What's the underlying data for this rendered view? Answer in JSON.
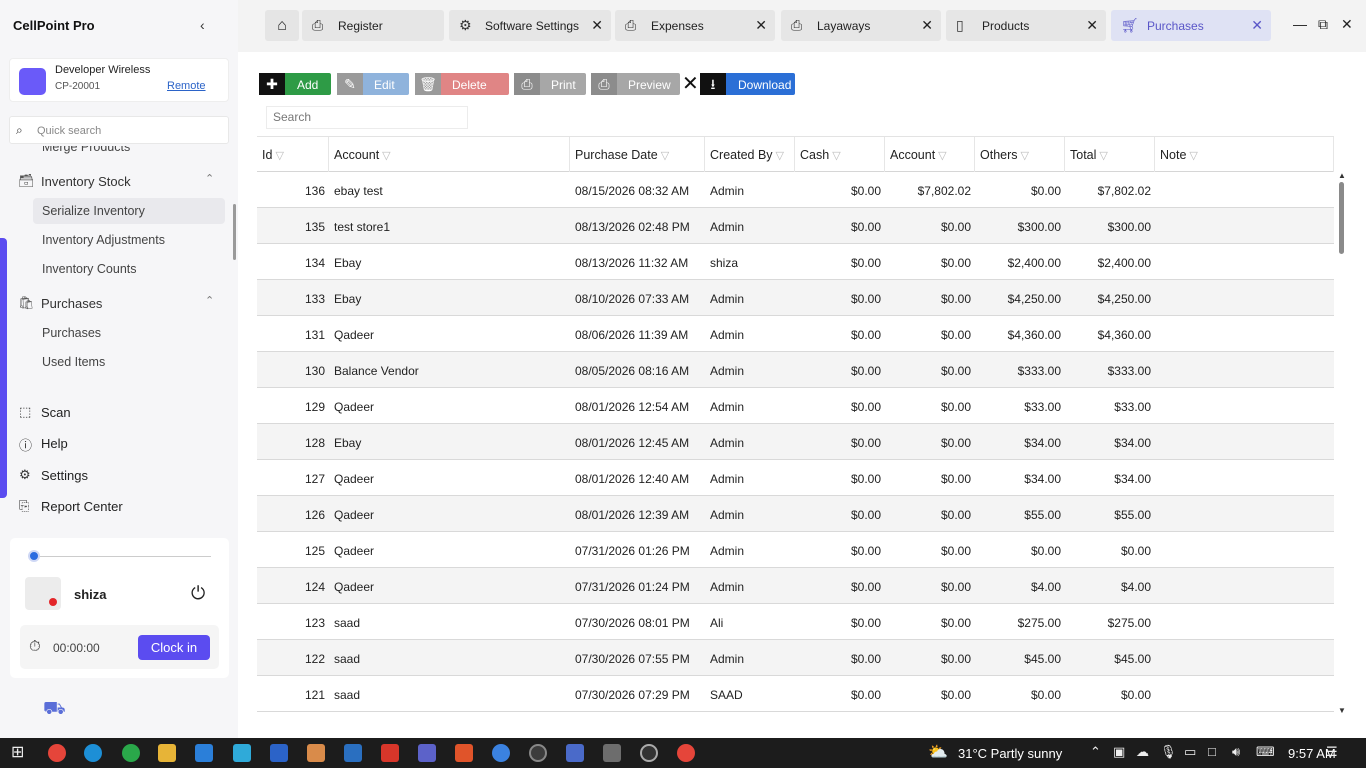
{
  "app": {
    "title": "CellPoint Pro"
  },
  "store": {
    "name": "Developer Wireless",
    "id": "CP-20001",
    "remote_label": "Remote"
  },
  "search": {
    "placeholder": "Quick search"
  },
  "sidebar": {
    "items": [
      {
        "label": "Merge Products"
      },
      {
        "label": "Inventory Stock",
        "icon": "box-icon"
      },
      {
        "label": "Serialize Inventory"
      },
      {
        "label": "Inventory Adjustments"
      },
      {
        "label": "Inventory Counts"
      },
      {
        "label": "Purchases",
        "icon": "bag-icon"
      },
      {
        "label": "Purchases"
      },
      {
        "label": "Used Items"
      }
    ],
    "bottom": [
      {
        "label": "Scan",
        "icon": "scan-icon"
      },
      {
        "label": "Help",
        "icon": "help-icon"
      },
      {
        "label": "Settings",
        "icon": "gear-icon"
      },
      {
        "label": "Report Center",
        "icon": "report-icon"
      }
    ]
  },
  "user": {
    "name": "shiza",
    "timer": "00:00:00",
    "clock_in_label": "Clock in"
  },
  "tabs": [
    {
      "label": "Register",
      "icon": "printer-icon"
    },
    {
      "label": "Software Settings",
      "icon": "settings-icon"
    },
    {
      "label": "Expenses",
      "icon": "printer-icon"
    },
    {
      "label": "Layaways",
      "icon": "printer-icon"
    },
    {
      "label": "Products",
      "icon": "phone-icon"
    },
    {
      "label": "Purchases",
      "icon": "basket-icon",
      "active": true
    }
  ],
  "toolbar": {
    "add": "Add",
    "edit": "Edit",
    "delete": "Delete",
    "print": "Print",
    "preview": "Preview",
    "download": "Download",
    "search_placeholder": "Search"
  },
  "table": {
    "columns": [
      "Id",
      "Account",
      "Purchase Date",
      "Created By",
      "Cash",
      "Account",
      "Others",
      "Total",
      "Note"
    ],
    "rows": [
      [
        "136",
        "ebay test",
        "08/15/2026 08:32 AM",
        "Admin",
        "$0.00",
        "$7,802.02",
        "$0.00",
        "$7,802.02",
        ""
      ],
      [
        "135",
        "test store1",
        "08/13/2026 02:48 PM",
        "Admin",
        "$0.00",
        "$0.00",
        "$300.00",
        "$300.00",
        ""
      ],
      [
        "134",
        "Ebay",
        "08/13/2026 11:32 AM",
        "shiza",
        "$0.00",
        "$0.00",
        "$2,400.00",
        "$2,400.00",
        ""
      ],
      [
        "133",
        "Ebay",
        "08/10/2026 07:33 AM",
        "Admin",
        "$0.00",
        "$0.00",
        "$4,250.00",
        "$4,250.00",
        ""
      ],
      [
        "131",
        "Qadeer",
        "08/06/2026 11:39 AM",
        "Admin",
        "$0.00",
        "$0.00",
        "$4,360.00",
        "$4,360.00",
        ""
      ],
      [
        "130",
        "Balance Vendor",
        "08/05/2026 08:16 AM",
        "Admin",
        "$0.00",
        "$0.00",
        "$333.00",
        "$333.00",
        ""
      ],
      [
        "129",
        "Qadeer",
        "08/01/2026 12:54 AM",
        "Admin",
        "$0.00",
        "$0.00",
        "$33.00",
        "$33.00",
        ""
      ],
      [
        "128",
        "Ebay",
        "08/01/2026 12:45 AM",
        "Admin",
        "$0.00",
        "$0.00",
        "$34.00",
        "$34.00",
        ""
      ],
      [
        "127",
        "Qadeer",
        "08/01/2026 12:40 AM",
        "Admin",
        "$0.00",
        "$0.00",
        "$34.00",
        "$34.00",
        ""
      ],
      [
        "126",
        "Qadeer",
        "08/01/2026 12:39 AM",
        "Admin",
        "$0.00",
        "$0.00",
        "$55.00",
        "$55.00",
        ""
      ],
      [
        "125",
        "Qadeer",
        "07/31/2026 01:26 PM",
        "Admin",
        "$0.00",
        "$0.00",
        "$0.00",
        "$0.00",
        ""
      ],
      [
        "124",
        "Qadeer",
        "07/31/2026 01:24 PM",
        "Admin",
        "$0.00",
        "$0.00",
        "$4.00",
        "$4.00",
        ""
      ],
      [
        "123",
        "saad",
        "07/30/2026 08:01 PM",
        "Ali",
        "$0.00",
        "$0.00",
        "$275.00",
        "$275.00",
        ""
      ],
      [
        "122",
        "saad",
        "07/30/2026 07:55 PM",
        "Admin",
        "$0.00",
        "$0.00",
        "$45.00",
        "$45.00",
        ""
      ],
      [
        "121",
        "saad",
        "07/30/2026 07:29 PM",
        "SAAD",
        "$0.00",
        "$0.00",
        "$0.00",
        "$0.00",
        ""
      ]
    ]
  },
  "taskbar": {
    "weather": "31°C  Partly sunny",
    "time": "9:57 AM"
  },
  "colors": {
    "accent": "#5b4cf0",
    "add": "#2e9b46",
    "edit": "#8fb3dc",
    "delete": "#e08585",
    "print": "#a7a7a7",
    "download": "#2b6fd6"
  }
}
